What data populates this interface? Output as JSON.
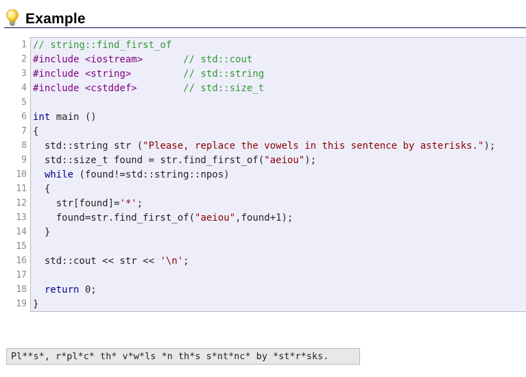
{
  "section": {
    "title": "Example",
    "icon": "lightbulb-icon"
  },
  "colors": {
    "comment": "#339933",
    "preprocessor": "#800080",
    "string": "#8b0000",
    "keyword": "#00008b",
    "plain": "#222222",
    "code_background": "#eeeefa",
    "output_background": "#e8e8e8"
  },
  "code": {
    "lines": [
      {
        "number": "1",
        "tokens": [
          {
            "t": "// string::find_first_of",
            "k": "comment"
          }
        ]
      },
      {
        "number": "2",
        "tokens": [
          {
            "t": "#include ",
            "k": "preprocessor"
          },
          {
            "t": "<iostream>",
            "k": "preprocessor"
          },
          {
            "t": "       // std::cout",
            "k": "comment"
          }
        ]
      },
      {
        "number": "3",
        "tokens": [
          {
            "t": "#include ",
            "k": "preprocessor"
          },
          {
            "t": "<string>",
            "k": "preprocessor"
          },
          {
            "t": "         // std::string",
            "k": "comment"
          }
        ]
      },
      {
        "number": "4",
        "tokens": [
          {
            "t": "#include ",
            "k": "preprocessor"
          },
          {
            "t": "<cstddef>",
            "k": "preprocessor"
          },
          {
            "t": "        // std::size_t",
            "k": "comment"
          }
        ]
      },
      {
        "number": "5",
        "tokens": []
      },
      {
        "number": "6",
        "tokens": [
          {
            "t": "int",
            "k": "keyword"
          },
          {
            "t": " main ()",
            "k": "plain"
          }
        ]
      },
      {
        "number": "7",
        "tokens": [
          {
            "t": "{",
            "k": "plain"
          }
        ]
      },
      {
        "number": "8",
        "tokens": [
          {
            "t": "  std::string str (",
            "k": "plain"
          },
          {
            "t": "\"Please, replace the vowels in this sentence by asterisks.\"",
            "k": "string"
          },
          {
            "t": ");",
            "k": "plain"
          }
        ]
      },
      {
        "number": "9",
        "tokens": [
          {
            "t": "  std::size_t found = str.find_first_of(",
            "k": "plain"
          },
          {
            "t": "\"aeiou\"",
            "k": "string"
          },
          {
            "t": ");",
            "k": "plain"
          }
        ]
      },
      {
        "number": "10",
        "tokens": [
          {
            "t": "  ",
            "k": "plain"
          },
          {
            "t": "while",
            "k": "keyword"
          },
          {
            "t": " (found!=std::string::npos)",
            "k": "plain"
          }
        ]
      },
      {
        "number": "11",
        "tokens": [
          {
            "t": "  {",
            "k": "plain"
          }
        ]
      },
      {
        "number": "12",
        "tokens": [
          {
            "t": "    str[found]=",
            "k": "plain"
          },
          {
            "t": "'*'",
            "k": "string"
          },
          {
            "t": ";",
            "k": "plain"
          }
        ]
      },
      {
        "number": "13",
        "tokens": [
          {
            "t": "    found=str.find_first_of(",
            "k": "plain"
          },
          {
            "t": "\"aeiou\"",
            "k": "string"
          },
          {
            "t": ",found+1);",
            "k": "plain"
          }
        ]
      },
      {
        "number": "14",
        "tokens": [
          {
            "t": "  }",
            "k": "plain"
          }
        ]
      },
      {
        "number": "15",
        "tokens": []
      },
      {
        "number": "16",
        "tokens": [
          {
            "t": "  std::cout << str << ",
            "k": "plain"
          },
          {
            "t": "'\\n'",
            "k": "string"
          },
          {
            "t": ";",
            "k": "plain"
          }
        ]
      },
      {
        "number": "17",
        "tokens": []
      },
      {
        "number": "18",
        "tokens": [
          {
            "t": "  ",
            "k": "plain"
          },
          {
            "t": "return",
            "k": "keyword"
          },
          {
            "t": " 0;",
            "k": "plain"
          }
        ]
      },
      {
        "number": "19",
        "tokens": [
          {
            "t": "}",
            "k": "plain"
          }
        ]
      }
    ]
  },
  "output": {
    "text": "Pl**s*, r*pl*c* th* v*w*ls *n th*s s*nt*nc* by *st*r*sks."
  }
}
